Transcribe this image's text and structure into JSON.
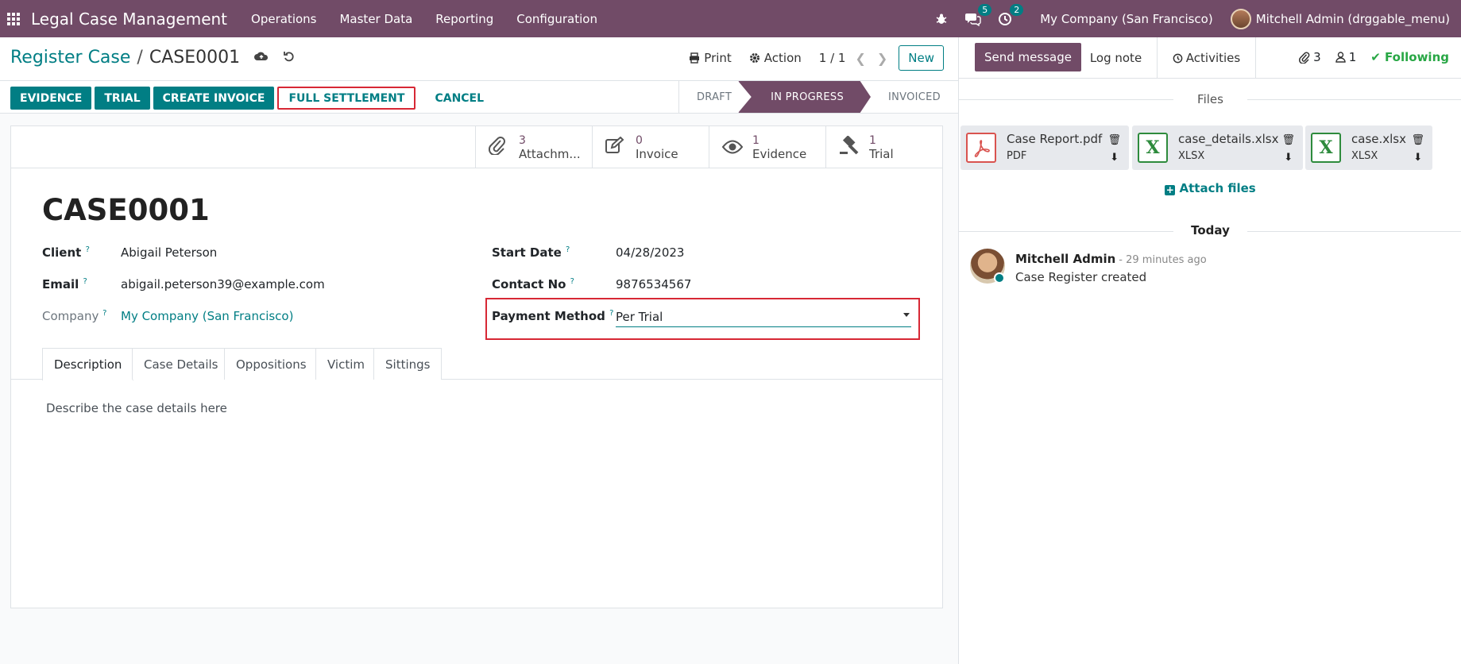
{
  "navbar": {
    "brand": "Legal Case Management",
    "menu": [
      "Operations",
      "Master Data",
      "Reporting",
      "Configuration"
    ],
    "messages_count": "5",
    "activities_count": "2",
    "company": "My Company (San Francisco)",
    "user": "Mitchell Admin (drggable_menu)"
  },
  "control": {
    "breadcrumb_parent": "Register Case",
    "breadcrumb_current": "CASE0001",
    "print_label": "Print",
    "action_label": "Action",
    "pager": "1 / 1",
    "new_label": "New"
  },
  "statusbar": {
    "buttons": [
      "EVIDENCE",
      "TRIAL",
      "CREATE INVOICE"
    ],
    "full_settlement": "FULL SETTLEMENT",
    "cancel": "CANCEL",
    "stages": [
      "DRAFT",
      "IN PROGRESS",
      "INVOICED"
    ]
  },
  "stat_buttons": [
    {
      "count": "3",
      "label": "Attachm..."
    },
    {
      "count": "0",
      "label": "Invoice"
    },
    {
      "count": "1",
      "label": "Evidence"
    },
    {
      "count": "1",
      "label": "Trial"
    }
  ],
  "record": {
    "title": "CASE0001",
    "client_label": "Client",
    "client": "Abigail Peterson",
    "email_label": "Email",
    "email": "abigail.peterson39@example.com",
    "company_label": "Company",
    "company": "My Company (San Francisco)",
    "start_date_label": "Start Date",
    "start_date": "04/28/2023",
    "contact_label": "Contact No",
    "contact": "9876534567",
    "payment_label": "Payment Method",
    "payment": "Per Trial",
    "help": "?"
  },
  "tabs": [
    "Description",
    "Case Details",
    "Oppositions",
    "Victim",
    "Sittings"
  ],
  "description_placeholder": "Describe the case details here",
  "chatter": {
    "send_message": "Send message",
    "log_note": "Log note",
    "activities": "Activities",
    "attachments_count": "3",
    "followers_count": "1",
    "following": "Following",
    "files_title": "Files",
    "files": [
      {
        "name": "Case Report.pdf",
        "ext": "PDF",
        "kind": "pdf"
      },
      {
        "name": "case_details.xlsx",
        "ext": "XLSX",
        "kind": "xls"
      },
      {
        "name": "case.xlsx",
        "ext": "XLSX",
        "kind": "xls"
      }
    ],
    "attach_files": "Attach files",
    "today": "Today",
    "message": {
      "author": "Mitchell Admin",
      "time": "- 29 minutes ago",
      "body": "Case Register created"
    }
  },
  "colors": {
    "brand": "#714b67",
    "accent": "#017e84",
    "highlight": "#d72835",
    "following": "#28a745"
  }
}
